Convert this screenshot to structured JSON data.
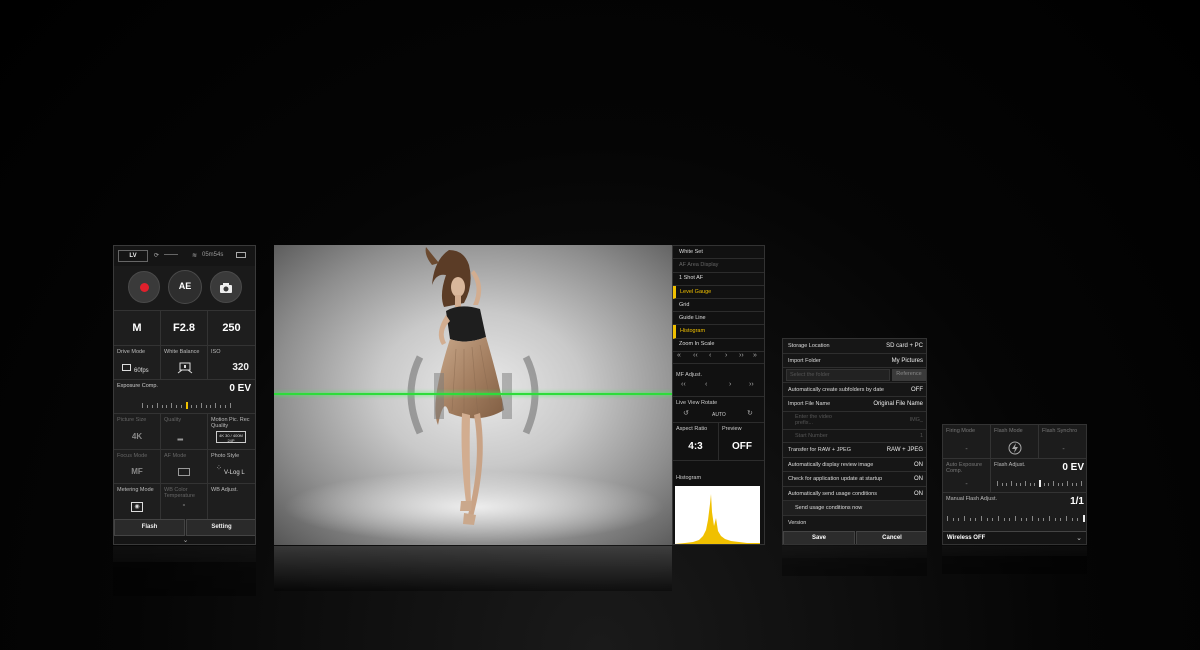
{
  "left_panel": {
    "lv_badge": "LV",
    "time_remaining": "05m54s",
    "ae_label": "AE",
    "exposure": {
      "mode": "M",
      "aperture": "F2.8",
      "shutter": "250"
    },
    "drive_mode": {
      "label": "Drive Mode",
      "value": "60fps"
    },
    "white_balance": {
      "label": "White Balance"
    },
    "iso": {
      "label": "ISO",
      "value": "320"
    },
    "exposure_comp": {
      "label": "Exposure Comp.",
      "value": "0 EV"
    },
    "picture_size": {
      "label": "Picture Size",
      "value": "4K"
    },
    "quality": {
      "label": "Quality"
    },
    "motion_pic": {
      "label": "Motion Pic. Rec Quality",
      "value": "4K 30 / 400M 24P"
    },
    "focus_mode": {
      "label": "Focus Mode",
      "value": "MF"
    },
    "af_mode": {
      "label": "AF Mode"
    },
    "photo_style": {
      "label": "Photo Style",
      "value": "V-Log L"
    },
    "metering_mode": {
      "label": "Metering Mode"
    },
    "wb_color_temp": {
      "label": "WB Color Temperature",
      "value": "-"
    },
    "wb_adjust": {
      "label": "WB Adjust."
    },
    "flash_button": "Flash",
    "setting_button": "Setting"
  },
  "right_menu": {
    "items": [
      {
        "label": "White Set",
        "state": "normal"
      },
      {
        "label": "AF Area Display",
        "state": "dim"
      },
      {
        "label": "1 Shot AF",
        "state": "normal"
      },
      {
        "label": "Level Gauge",
        "state": "active"
      },
      {
        "label": "Grid",
        "state": "normal"
      },
      {
        "label": "Guide Line",
        "state": "normal"
      },
      {
        "label": "Histogram",
        "state": "active"
      },
      {
        "label": "Zoom In Scale",
        "state": "normal"
      }
    ],
    "mf_adjust_label": "MF Adjust.",
    "live_view_rotate_label": "Live View Rotate",
    "rotate_auto": "AUTO",
    "aspect_ratio": {
      "label": "Aspect Ratio",
      "value": "4:3"
    },
    "preview": {
      "label": "Preview",
      "value": "OFF"
    },
    "histogram_label": "Histogram"
  },
  "settings_panel": {
    "rows": [
      {
        "label": "Storage Location",
        "value": "SD card + PC"
      },
      {
        "label": "Import Folder",
        "value": "My Pictures"
      }
    ],
    "folder_placeholder": "Select the folder",
    "reference_button": "Reference",
    "rows2": [
      {
        "label": "Automatically create subfolders by date",
        "value": "OFF"
      },
      {
        "label": "Import File Name",
        "value": "Original File Name"
      }
    ],
    "video_prefix": {
      "label": "Enter the video prefix...",
      "value": "IMG_"
    },
    "start_number": {
      "label": "Start Number",
      "value": "1"
    },
    "rows3": [
      {
        "label": "Transfer for RAW + JPEG",
        "value": "RAW + JPEG"
      },
      {
        "label": "Automatically display review image",
        "value": "ON"
      },
      {
        "label": "Check for application update at startup",
        "value": "ON"
      },
      {
        "label": "Automatically send usage conditions",
        "value": "ON"
      }
    ],
    "send_usage": "Send usage conditions now",
    "version_label": "Version",
    "save_button": "Save",
    "cancel_button": "Cancel"
  },
  "flash_panel": {
    "firing_mode": {
      "label": "Firing Mode",
      "value": "-"
    },
    "flash_mode": {
      "label": "Flash Mode"
    },
    "flash_synchro": {
      "label": "Flash Synchro",
      "value": "-"
    },
    "auto_exposure_comp": {
      "label": "Auto Exposure Comp.",
      "value": "-"
    },
    "flash_adjust": {
      "label": "Flash Adjust.",
      "value": "0 EV"
    },
    "manual_flash_adjust": {
      "label": "Manual Flash Adjust.",
      "value": "1/1"
    },
    "wireless": "Wireless OFF"
  },
  "histogram": {
    "color": "#f0c000",
    "background": "#ffffff"
  },
  "colors": {
    "level_line": "#2ddc3a",
    "accent": "#f0c000",
    "record": "#e0202c"
  }
}
